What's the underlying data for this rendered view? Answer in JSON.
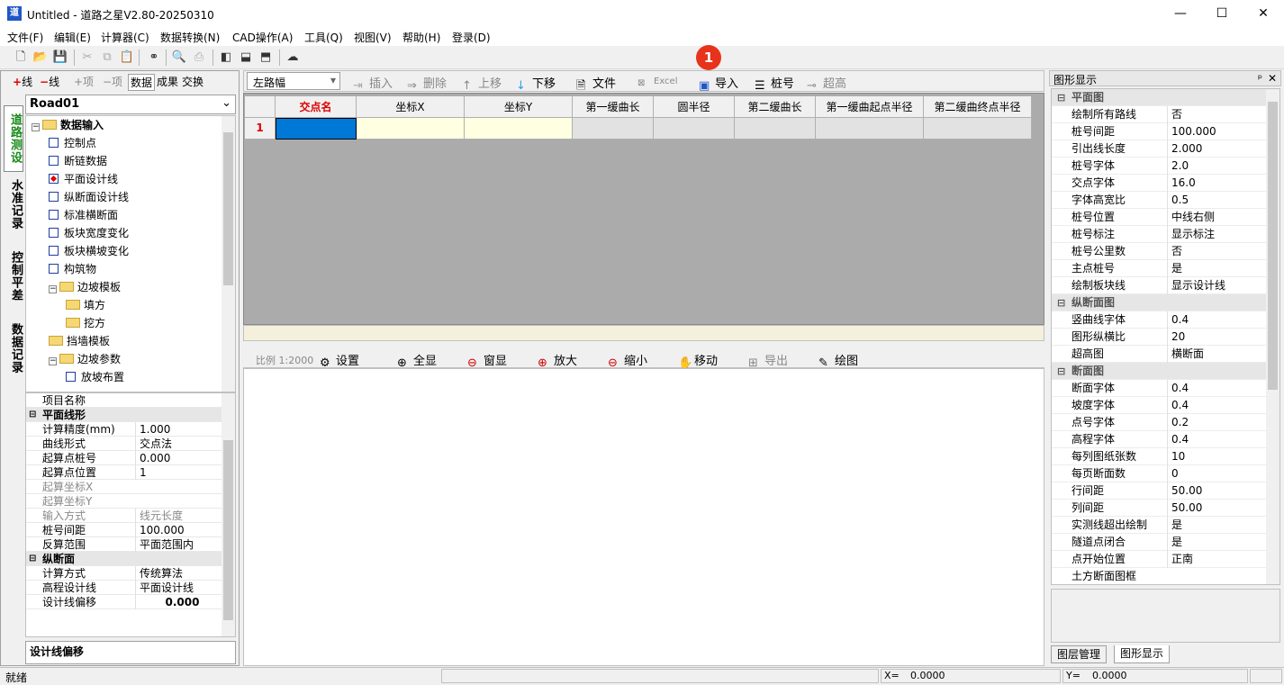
{
  "window": {
    "title": "Untitled - 道路之星V2.80-20250310",
    "icon": "道",
    "min": "—",
    "max": "☐",
    "close": "✕"
  },
  "menu": [
    "文件(F)",
    "编辑(E)",
    "计算器(C)",
    "数据转换(N)",
    "CAD操作(A)",
    "工具(Q)",
    "视图(V)",
    "帮助(H)",
    "登录(D)"
  ],
  "left_tabs": {
    "add_line": "+线",
    "del_line": "−线",
    "add_item": "+项",
    "del_item": "−项",
    "data": "数据",
    "result": "成果",
    "exchange": "交换"
  },
  "road_select": "Road01",
  "vertical_tabs": [
    "道路测设",
    "水准记录",
    "控制平差",
    "数据记录"
  ],
  "tree": [
    {
      "label": "数据输入",
      "type": "folder",
      "level": 0,
      "exp": "−",
      "bold": true
    },
    {
      "label": "控制点",
      "type": "check",
      "level": 1
    },
    {
      "label": "断链数据",
      "type": "check",
      "level": 1
    },
    {
      "label": "平面设计线",
      "type": "check",
      "level": 1,
      "on": true
    },
    {
      "label": "纵断面设计线",
      "type": "check",
      "level": 1
    },
    {
      "label": "标准横断面",
      "type": "check",
      "level": 1
    },
    {
      "label": "板块宽度变化",
      "type": "check",
      "level": 1
    },
    {
      "label": "板块横坡变化",
      "type": "check",
      "level": 1
    },
    {
      "label": "构筑物",
      "type": "check",
      "level": 1
    },
    {
      "label": "边坡模板",
      "type": "folder",
      "level": 1,
      "exp": "−"
    },
    {
      "label": "填方",
      "type": "folder",
      "level": 2
    },
    {
      "label": "挖方",
      "type": "folder",
      "level": 2
    },
    {
      "label": "挡墙模板",
      "type": "folder",
      "level": 1
    },
    {
      "label": "边坡参数",
      "type": "folder",
      "level": 1,
      "exp": "−"
    },
    {
      "label": "放坡布置",
      "type": "check",
      "level": 2
    }
  ],
  "props": [
    {
      "k": "项目名称",
      "v": ""
    },
    {
      "cat": "平面线形"
    },
    {
      "k": "计算精度(mm)",
      "v": "1.000"
    },
    {
      "k": "曲线形式",
      "v": "交点法"
    },
    {
      "k": "起算点桩号",
      "v": "0.000"
    },
    {
      "k": "起算点位置",
      "v": "1"
    },
    {
      "k": "起算坐标X",
      "v": "",
      "dim": true
    },
    {
      "k": "起算坐标Y",
      "v": "",
      "dim": true
    },
    {
      "k": "输入方式",
      "v": "线元长度",
      "dim": true
    },
    {
      "k": "桩号间距",
      "v": "100.000"
    },
    {
      "k": "反算范围",
      "v": "平面范围内"
    },
    {
      "cat": "纵断面"
    },
    {
      "k": "计算方式",
      "v": "传统算法"
    },
    {
      "k": "高程设计线",
      "v": "平面设计线"
    },
    {
      "k": "设计线偏移",
      "v": "0.000",
      "bold": true
    }
  ],
  "prop_desc": "设计线偏移",
  "main_toolbar": {
    "combo": "左路幅",
    "insert": "插入",
    "delete": "删除",
    "up": "上移",
    "down": "下移",
    "file": "文件",
    "excel": "Excel",
    "import": "导入",
    "station": "桩号",
    "superelev": "超高"
  },
  "grid": {
    "headers": [
      "交点名",
      "坐标X",
      "坐标Y",
      "第一缓曲长",
      "圆半径",
      "第二缓曲长",
      "第一缓曲起点半径",
      "第二缓曲终点半径"
    ],
    "row_num": "1"
  },
  "draw_toolbar": {
    "scale": "比例 1:2000",
    "settings": "设置",
    "fullview": "全显",
    "window": "窗显",
    "zoomin": "放大",
    "zoomout": "缩小",
    "move": "移动",
    "export": "导出",
    "draw": "绘图"
  },
  "right_panel": {
    "title": "图形显示",
    "pin": "ᵖ",
    "close": "✕",
    "rows": [
      {
        "cat": "平面图"
      },
      {
        "k": "绘制所有路线",
        "v": "否"
      },
      {
        "k": "桩号间距",
        "v": "100.000"
      },
      {
        "k": "引出线长度",
        "v": "2.000"
      },
      {
        "k": "桩号字体",
        "v": "2.0"
      },
      {
        "k": "交点字体",
        "v": "16.0"
      },
      {
        "k": "字体高宽比",
        "v": "0.5"
      },
      {
        "k": "桩号位置",
        "v": "中线右侧"
      },
      {
        "k": "桩号标注",
        "v": "显示标注"
      },
      {
        "k": "桩号公里数",
        "v": "否"
      },
      {
        "k": "主点桩号",
        "v": "是"
      },
      {
        "k": "绘制板块线",
        "v": "显示设计线"
      },
      {
        "cat": "纵断面图"
      },
      {
        "k": "竖曲线字体",
        "v": "0.4"
      },
      {
        "k": "图形纵横比",
        "v": "20"
      },
      {
        "k": "超高图",
        "v": "横断面"
      },
      {
        "cat": "断面图"
      },
      {
        "k": "断面字体",
        "v": "0.4"
      },
      {
        "k": "坡度字体",
        "v": "0.4"
      },
      {
        "k": "点号字体",
        "v": "0.2"
      },
      {
        "k": "高程字体",
        "v": "0.4"
      },
      {
        "k": "每列图纸张数",
        "v": "10"
      },
      {
        "k": "每页断面数",
        "v": "0"
      },
      {
        "k": "行间距",
        "v": "50.00"
      },
      {
        "k": "列间距",
        "v": "50.00"
      },
      {
        "k": "实测线超出绘制",
        "v": "是"
      },
      {
        "k": "隧道点闭合",
        "v": "是"
      },
      {
        "k": "点开始位置",
        "v": "正南"
      },
      {
        "k": "土方断面图框",
        "v": ""
      }
    ],
    "tabs": [
      "图层管理",
      "图形显示"
    ]
  },
  "status": {
    "ready": "就绪",
    "x_label": "X=",
    "x_val": "0.0000",
    "y_label": "Y=",
    "y_val": "0.0000"
  },
  "badge": "1"
}
